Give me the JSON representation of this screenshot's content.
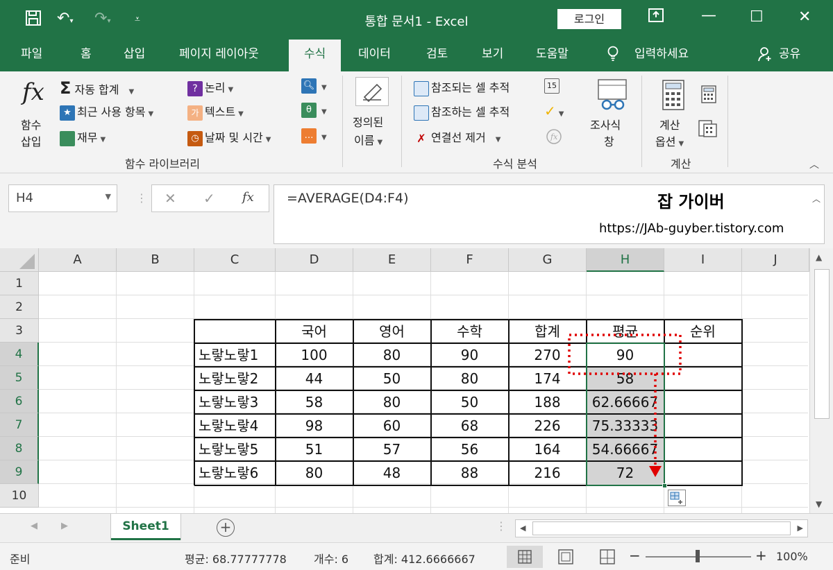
{
  "window": {
    "title": "통합 문서1  -  Excel",
    "login_label": "로그인"
  },
  "tabs": [
    "파일",
    "홈",
    "삽입",
    "페이지 레이아웃",
    "수식",
    "데이터",
    "검토",
    "보기",
    "도움말",
    "입력하세요",
    "공유"
  ],
  "active_tab": "수식",
  "ribbon": {
    "insert_function": [
      "함수",
      "삽입"
    ],
    "autosum": "자동 합계",
    "recent": "최근 사용 항목",
    "financial": "재무",
    "logical": "논리",
    "text": "텍스트",
    "datetime": "날짜 및 시간",
    "function_library_label": "함수 라이브러리",
    "defined_names": [
      "정의된",
      "이름"
    ],
    "trace_precedents": "참조되는 셀 추적",
    "trace_dependents": "참조하는 셀 추적",
    "remove_arrows": "연결선 제거",
    "watch": [
      "조사식",
      "창"
    ],
    "formula_auditing_label": "수식 분석",
    "calc_options": [
      "계산",
      "옵션"
    ],
    "calculation_label": "계산"
  },
  "formula_bar": {
    "name_box": "H4",
    "formula": "=AVERAGE(D4:F4)",
    "brand": "잡 가이버",
    "url": "https://JAb-guyber.tistory.com"
  },
  "columns": [
    "A",
    "B",
    "C",
    "D",
    "E",
    "F",
    "G",
    "H",
    "I",
    "J"
  ],
  "rows": [
    "1",
    "2",
    "3",
    "4",
    "5",
    "6",
    "7",
    "8",
    "9",
    "10"
  ],
  "table": {
    "headers": [
      "국어",
      "영어",
      "수학",
      "합계",
      "평균",
      "순위"
    ],
    "rows": [
      [
        "노랗노랗1",
        "100",
        "80",
        "90",
        "270",
        "90"
      ],
      [
        "노랗노랗2",
        "44",
        "50",
        "80",
        "174",
        "58"
      ],
      [
        "노랗노랗3",
        "58",
        "80",
        "50",
        "188",
        "62.66667"
      ],
      [
        "노랗노랗4",
        "98",
        "60",
        "68",
        "226",
        "75.33333"
      ],
      [
        "노랗노랗5",
        "51",
        "57",
        "56",
        "164",
        "54.66667"
      ],
      [
        "노랗노랗6",
        "80",
        "48",
        "88",
        "216",
        "72"
      ]
    ]
  },
  "sheet": {
    "name": "Sheet1"
  },
  "status": {
    "ready": "준비",
    "average": "평균: 68.77777778",
    "count": "개수: 6",
    "sum": "합계: 412.6666667",
    "zoom": "100%"
  },
  "colors": {
    "excel_green": "#217346",
    "annotation_red": "#e00000"
  }
}
